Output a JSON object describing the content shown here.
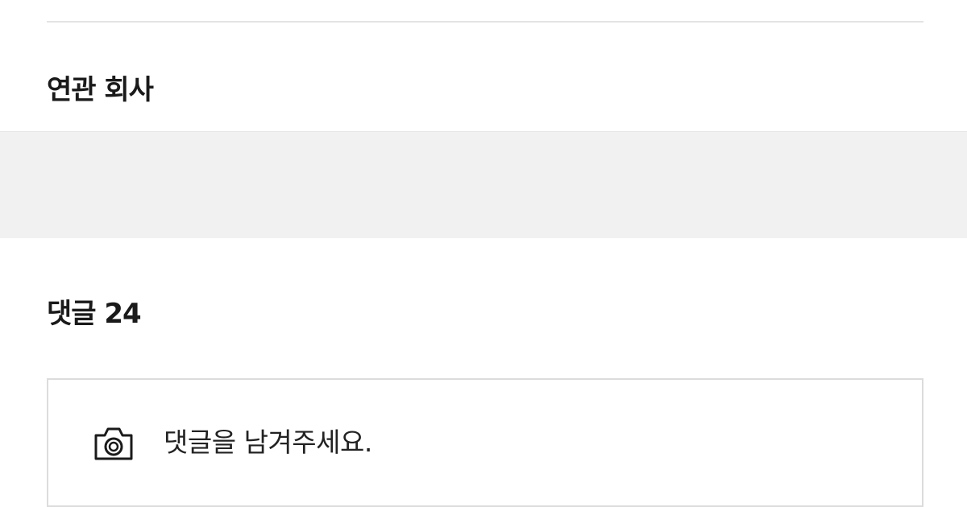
{
  "related_section": {
    "title": "연관 회사"
  },
  "comments_section": {
    "title": "댓글 24",
    "input": {
      "placeholder": "댓글을 남겨주세요.",
      "attach_icon": "camera-icon"
    }
  },
  "colors": {
    "divider": "#e3e3e3",
    "band_background": "#f1f1f1",
    "input_border": "#dcdcdc",
    "text": "#1a1a1a"
  }
}
